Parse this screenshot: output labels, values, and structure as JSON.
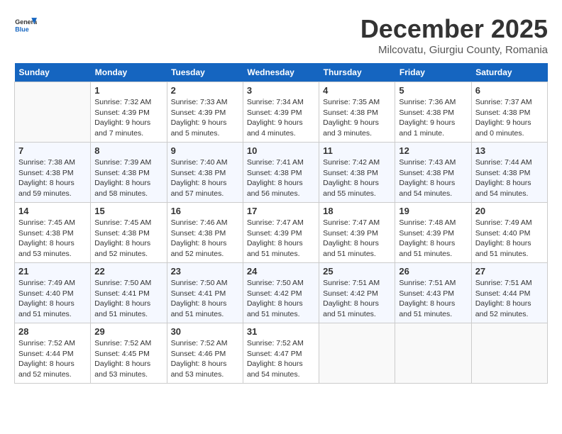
{
  "header": {
    "logo_general": "General",
    "logo_blue": "Blue",
    "month": "December 2025",
    "location": "Milcovatu, Giurgiu County, Romania"
  },
  "weekdays": [
    "Sunday",
    "Monday",
    "Tuesday",
    "Wednesday",
    "Thursday",
    "Friday",
    "Saturday"
  ],
  "weeks": [
    [
      {
        "day": "",
        "sunrise": "",
        "sunset": "",
        "daylight": ""
      },
      {
        "day": "1",
        "sunrise": "Sunrise: 7:32 AM",
        "sunset": "Sunset: 4:39 PM",
        "daylight": "Daylight: 9 hours and 7 minutes."
      },
      {
        "day": "2",
        "sunrise": "Sunrise: 7:33 AM",
        "sunset": "Sunset: 4:39 PM",
        "daylight": "Daylight: 9 hours and 5 minutes."
      },
      {
        "day": "3",
        "sunrise": "Sunrise: 7:34 AM",
        "sunset": "Sunset: 4:39 PM",
        "daylight": "Daylight: 9 hours and 4 minutes."
      },
      {
        "day": "4",
        "sunrise": "Sunrise: 7:35 AM",
        "sunset": "Sunset: 4:38 PM",
        "daylight": "Daylight: 9 hours and 3 minutes."
      },
      {
        "day": "5",
        "sunrise": "Sunrise: 7:36 AM",
        "sunset": "Sunset: 4:38 PM",
        "daylight": "Daylight: 9 hours and 1 minute."
      },
      {
        "day": "6",
        "sunrise": "Sunrise: 7:37 AM",
        "sunset": "Sunset: 4:38 PM",
        "daylight": "Daylight: 9 hours and 0 minutes."
      }
    ],
    [
      {
        "day": "7",
        "sunrise": "Sunrise: 7:38 AM",
        "sunset": "Sunset: 4:38 PM",
        "daylight": "Daylight: 8 hours and 59 minutes."
      },
      {
        "day": "8",
        "sunrise": "Sunrise: 7:39 AM",
        "sunset": "Sunset: 4:38 PM",
        "daylight": "Daylight: 8 hours and 58 minutes."
      },
      {
        "day": "9",
        "sunrise": "Sunrise: 7:40 AM",
        "sunset": "Sunset: 4:38 PM",
        "daylight": "Daylight: 8 hours and 57 minutes."
      },
      {
        "day": "10",
        "sunrise": "Sunrise: 7:41 AM",
        "sunset": "Sunset: 4:38 PM",
        "daylight": "Daylight: 8 hours and 56 minutes."
      },
      {
        "day": "11",
        "sunrise": "Sunrise: 7:42 AM",
        "sunset": "Sunset: 4:38 PM",
        "daylight": "Daylight: 8 hours and 55 minutes."
      },
      {
        "day": "12",
        "sunrise": "Sunrise: 7:43 AM",
        "sunset": "Sunset: 4:38 PM",
        "daylight": "Daylight: 8 hours and 54 minutes."
      },
      {
        "day": "13",
        "sunrise": "Sunrise: 7:44 AM",
        "sunset": "Sunset: 4:38 PM",
        "daylight": "Daylight: 8 hours and 54 minutes."
      }
    ],
    [
      {
        "day": "14",
        "sunrise": "Sunrise: 7:45 AM",
        "sunset": "Sunset: 4:38 PM",
        "daylight": "Daylight: 8 hours and 53 minutes."
      },
      {
        "day": "15",
        "sunrise": "Sunrise: 7:45 AM",
        "sunset": "Sunset: 4:38 PM",
        "daylight": "Daylight: 8 hours and 52 minutes."
      },
      {
        "day": "16",
        "sunrise": "Sunrise: 7:46 AM",
        "sunset": "Sunset: 4:38 PM",
        "daylight": "Daylight: 8 hours and 52 minutes."
      },
      {
        "day": "17",
        "sunrise": "Sunrise: 7:47 AM",
        "sunset": "Sunset: 4:39 PM",
        "daylight": "Daylight: 8 hours and 51 minutes."
      },
      {
        "day": "18",
        "sunrise": "Sunrise: 7:47 AM",
        "sunset": "Sunset: 4:39 PM",
        "daylight": "Daylight: 8 hours and 51 minutes."
      },
      {
        "day": "19",
        "sunrise": "Sunrise: 7:48 AM",
        "sunset": "Sunset: 4:39 PM",
        "daylight": "Daylight: 8 hours and 51 minutes."
      },
      {
        "day": "20",
        "sunrise": "Sunrise: 7:49 AM",
        "sunset": "Sunset: 4:40 PM",
        "daylight": "Daylight: 8 hours and 51 minutes."
      }
    ],
    [
      {
        "day": "21",
        "sunrise": "Sunrise: 7:49 AM",
        "sunset": "Sunset: 4:40 PM",
        "daylight": "Daylight: 8 hours and 51 minutes."
      },
      {
        "day": "22",
        "sunrise": "Sunrise: 7:50 AM",
        "sunset": "Sunset: 4:41 PM",
        "daylight": "Daylight: 8 hours and 51 minutes."
      },
      {
        "day": "23",
        "sunrise": "Sunrise: 7:50 AM",
        "sunset": "Sunset: 4:41 PM",
        "daylight": "Daylight: 8 hours and 51 minutes."
      },
      {
        "day": "24",
        "sunrise": "Sunrise: 7:50 AM",
        "sunset": "Sunset: 4:42 PM",
        "daylight": "Daylight: 8 hours and 51 minutes."
      },
      {
        "day": "25",
        "sunrise": "Sunrise: 7:51 AM",
        "sunset": "Sunset: 4:42 PM",
        "daylight": "Daylight: 8 hours and 51 minutes."
      },
      {
        "day": "26",
        "sunrise": "Sunrise: 7:51 AM",
        "sunset": "Sunset: 4:43 PM",
        "daylight": "Daylight: 8 hours and 51 minutes."
      },
      {
        "day": "27",
        "sunrise": "Sunrise: 7:51 AM",
        "sunset": "Sunset: 4:44 PM",
        "daylight": "Daylight: 8 hours and 52 minutes."
      }
    ],
    [
      {
        "day": "28",
        "sunrise": "Sunrise: 7:52 AM",
        "sunset": "Sunset: 4:44 PM",
        "daylight": "Daylight: 8 hours and 52 minutes."
      },
      {
        "day": "29",
        "sunrise": "Sunrise: 7:52 AM",
        "sunset": "Sunset: 4:45 PM",
        "daylight": "Daylight: 8 hours and 53 minutes."
      },
      {
        "day": "30",
        "sunrise": "Sunrise: 7:52 AM",
        "sunset": "Sunset: 4:46 PM",
        "daylight": "Daylight: 8 hours and 53 minutes."
      },
      {
        "day": "31",
        "sunrise": "Sunrise: 7:52 AM",
        "sunset": "Sunset: 4:47 PM",
        "daylight": "Daylight: 8 hours and 54 minutes."
      },
      {
        "day": "",
        "sunrise": "",
        "sunset": "",
        "daylight": ""
      },
      {
        "day": "",
        "sunrise": "",
        "sunset": "",
        "daylight": ""
      },
      {
        "day": "",
        "sunrise": "",
        "sunset": "",
        "daylight": ""
      }
    ]
  ]
}
